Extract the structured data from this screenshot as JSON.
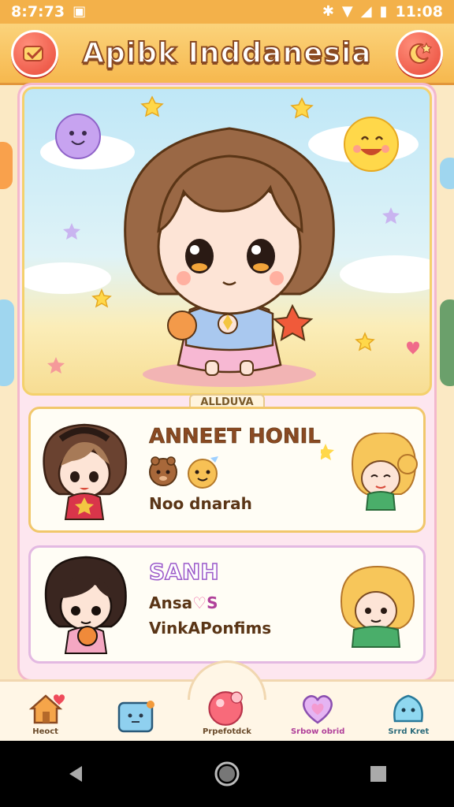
{
  "status_bar": {
    "time": "8:7:73",
    "battery_time": "11:08"
  },
  "header": {
    "title": "Apibk Inddanesia",
    "left_icon": "menu-badge-icon",
    "right_icon": "moon-star-icon"
  },
  "hero": {
    "section_label": "ALLDUVA"
  },
  "cards": [
    {
      "name": "ANNEET HONIL",
      "subtitle": "Noo dnarah"
    },
    {
      "name": "SANH",
      "subtitle_line1": "Ansa",
      "subtitle_line1_suffix": "S",
      "subtitle_line2": "VinkAPonfims"
    }
  ],
  "bottom_nav": [
    {
      "label": "Heoct",
      "icon": "home-icon"
    },
    {
      "label": "",
      "icon": "chat-face-icon"
    },
    {
      "label": "Prpefotdck",
      "icon": "bubble-icon"
    },
    {
      "label": "Srbow obrid",
      "icon": "heart-icon"
    },
    {
      "label": "Srrd Kret",
      "icon": "slime-icon"
    }
  ],
  "colors": {
    "accent": "#f3b14a",
    "card_border": "#f1c76b",
    "name_brown": "#8a4a22",
    "name_purple": "#9b59c9"
  }
}
